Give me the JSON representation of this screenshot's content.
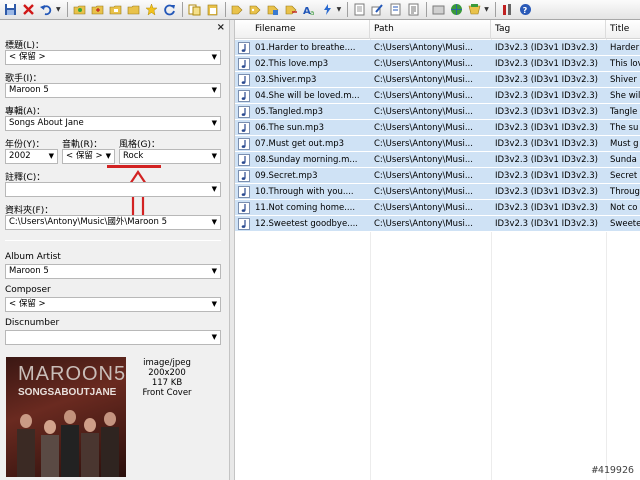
{
  "toolbar": {
    "icons": [
      "save-icon",
      "delete-icon",
      "undo-icon",
      "open-folder-icon",
      "add-folder-icon",
      "folder-icon",
      "folder-alt-icon",
      "folder-open-icon",
      "favorite-icon",
      "refresh-icon",
      "copy-icon",
      "paste-icon",
      "tag-source-icon",
      "tag-edit-icon",
      "tag-convert-icon",
      "tag-copy-icon",
      "tag-case-icon",
      "actions-icon",
      "text-file-icon",
      "edit-icon",
      "export-icon",
      "playlist-icon",
      "options-icon",
      "web-icon",
      "tools-icon",
      "settings-icon",
      "help-icon"
    ]
  },
  "tag_panel": {
    "close_label": "×",
    "title": {
      "label": "標題(L)：",
      "value": "< 保留 >"
    },
    "artist": {
      "label": "歌手(I)：",
      "value": "Maroon 5"
    },
    "album": {
      "label": "專輯(A)：",
      "value": "Songs About Jane"
    },
    "year": {
      "label": "年份(Y)：",
      "value": "2002"
    },
    "track": {
      "label": "音軌(R)：",
      "value": "< 保留 >"
    },
    "genre": {
      "label": "風格(G)：",
      "value": "Rock"
    },
    "comment": {
      "label": "註釋(C)：",
      "value": ""
    },
    "directory": {
      "label": "資料夾(F)：",
      "value": "C:\\Users\\Antony\\Music\\國外\\Maroon 5"
    },
    "album_artist": {
      "label": "Album Artist",
      "value": "Maroon 5"
    },
    "composer": {
      "label": "Composer",
      "value": "< 保留 >"
    },
    "discnumber": {
      "label": "Discnumber",
      "value": ""
    },
    "cover": {
      "band_text": "MAROON5",
      "album_text": "SONGSABOUTJANE",
      "mime": "image/jpeg",
      "dimensions": "200x200",
      "size": "117 KB",
      "type": "Front Cover"
    }
  },
  "file_list": {
    "columns": [
      "Filename",
      "Path",
      "Tag",
      "Title"
    ],
    "rows": [
      {
        "filename": "01.Harder to breathe....",
        "path": "C:\\Users\\Antony\\Musi...",
        "tag": "ID3v2.3 (ID3v1 ID3v2.3)",
        "title": "Harder"
      },
      {
        "filename": "02.This love.mp3",
        "path": "C:\\Users\\Antony\\Musi...",
        "tag": "ID3v2.3 (ID3v1 ID3v2.3)",
        "title": "This lov"
      },
      {
        "filename": "03.Shiver.mp3",
        "path": "C:\\Users\\Antony\\Musi...",
        "tag": "ID3v2.3 (ID3v1 ID3v2.3)",
        "title": "Shiver"
      },
      {
        "filename": "04.She will be loved.m...",
        "path": "C:\\Users\\Antony\\Musi...",
        "tag": "ID3v2.3 (ID3v1 ID3v2.3)",
        "title": "She will"
      },
      {
        "filename": "05.Tangled.mp3",
        "path": "C:\\Users\\Antony\\Musi...",
        "tag": "ID3v2.3 (ID3v1 ID3v2.3)",
        "title": "Tangle"
      },
      {
        "filename": "06.The sun.mp3",
        "path": "C:\\Users\\Antony\\Musi...",
        "tag": "ID3v2.3 (ID3v1 ID3v2.3)",
        "title": "The su"
      },
      {
        "filename": "07.Must get out.mp3",
        "path": "C:\\Users\\Antony\\Musi...",
        "tag": "ID3v2.3 (ID3v1 ID3v2.3)",
        "title": "Must g"
      },
      {
        "filename": "08.Sunday morning.m...",
        "path": "C:\\Users\\Antony\\Musi...",
        "tag": "ID3v2.3 (ID3v1 ID3v2.3)",
        "title": "Sunda"
      },
      {
        "filename": "09.Secret.mp3",
        "path": "C:\\Users\\Antony\\Musi...",
        "tag": "ID3v2.3 (ID3v1 ID3v2.3)",
        "title": "Secret"
      },
      {
        "filename": "10.Through with you....",
        "path": "C:\\Users\\Antony\\Musi...",
        "tag": "ID3v2.3 (ID3v1 ID3v2.3)",
        "title": "Throug"
      },
      {
        "filename": "11.Not coming home....",
        "path": "C:\\Users\\Antony\\Musi...",
        "tag": "ID3v2.3 (ID3v1 ID3v2.3)",
        "title": "Not co"
      },
      {
        "filename": "12.Sweetest goodbye....",
        "path": "C:\\Users\\Antony\\Musi...",
        "tag": "ID3v2.3 (ID3v1 ID3v2.3)",
        "title": "Sweete"
      }
    ]
  },
  "watermark": "#419926",
  "colors": {
    "selection": "#cfe2f5",
    "annotation": "#d22222",
    "panel": "#f0f0f0"
  }
}
